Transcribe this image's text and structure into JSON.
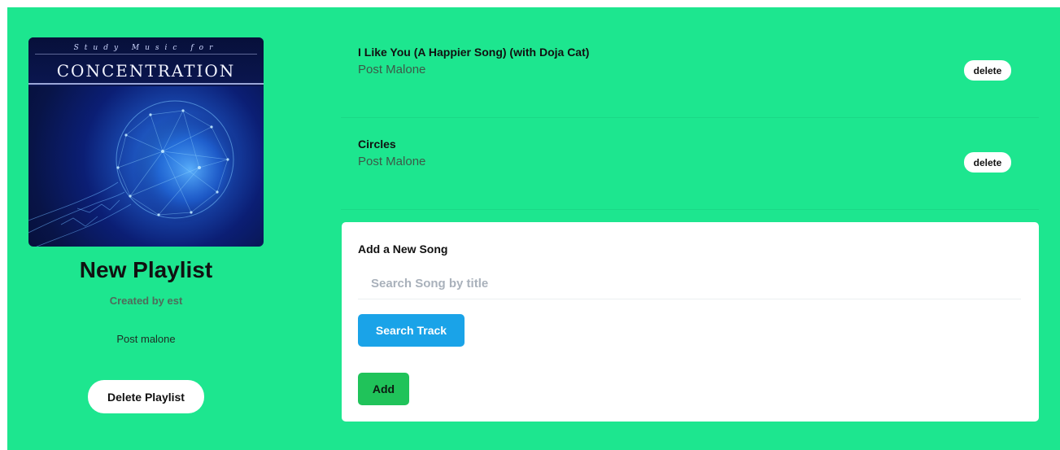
{
  "playlist": {
    "cover": {
      "script_text": "Study Music for",
      "title_text": "CONCENTRATION"
    },
    "title": "New Playlist",
    "created_by": "Created by est",
    "description": "Post malone",
    "delete_label": "Delete Playlist"
  },
  "songs": [
    {
      "title": "I Like You (A Happier Song) (with Doja Cat)",
      "artist": "Post Malone",
      "delete_label": "delete"
    },
    {
      "title": "Circles",
      "artist": "Post Malone",
      "delete_label": "delete"
    }
  ],
  "add_song": {
    "heading": "Add a New Song",
    "search_placeholder": "Search Song by title",
    "search_value": "",
    "search_button": "Search Track",
    "add_button": "Add"
  },
  "colors": {
    "background": "#1de68f",
    "card": "#ffffff",
    "search_button": "#1aa3e8",
    "add_button": "#20c35a"
  }
}
